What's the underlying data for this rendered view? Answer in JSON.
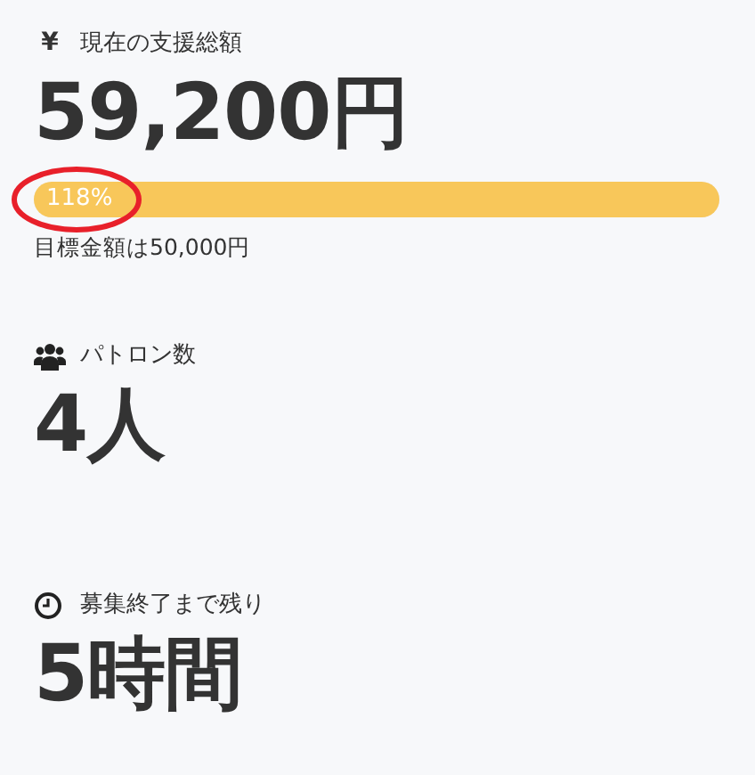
{
  "stats": [
    {
      "kind": "yen",
      "icon": "¥",
      "label": "現在の支援総額",
      "value": "59,200円",
      "progress": {
        "level": 1,
        "label": "118%",
        "circled": true
      },
      "note": "目標金額は50,000円"
    },
    {
      "kind": "people",
      "label": "パトロン数",
      "value": "4人"
    },
    {
      "kind": "clock",
      "label": "募集終了まで残り",
      "value": "5時間"
    }
  ]
}
